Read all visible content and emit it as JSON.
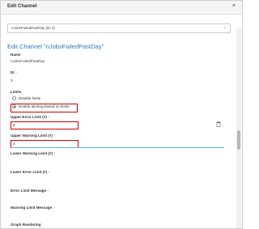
{
  "dialog": {
    "title": "Edit Channel",
    "close_glyph": "×"
  },
  "selector": {
    "value": "nJobsFailedPastDay (ID 3)",
    "chevron": "⌄"
  },
  "form": {
    "heading": "Edit Channel \"nJobsFailedPastDay\"",
    "name_label": "Name",
    "name_value": "nJobsFailedPastDay",
    "id_label": "ID",
    "id_value": "3",
    "limits_label": "Limits",
    "limits_options": [
      "Disable limits",
      "Enable alerting based on limits"
    ],
    "upper_error_label": "Upper Error Limit (#)",
    "upper_error_value": "5",
    "upper_warning_label": "Upper Warning Limit (#)",
    "upper_warning_value": "3",
    "lower_warning_label": "Lower Warning Limit (#)",
    "lower_error_label": "Lower Error Limit (#)",
    "error_message_label": "Error Limit Message",
    "warning_message_label": "Warning Limit Message",
    "graph_rendering_label": "Graph Rendering"
  },
  "help_glyph": "?"
}
